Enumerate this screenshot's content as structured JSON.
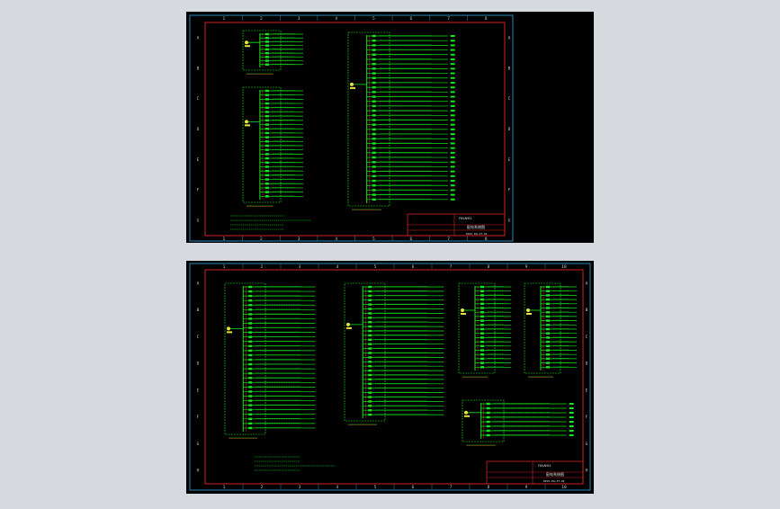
{
  "colors": {
    "background": "#d6d9dd",
    "paper": "#000000",
    "frame": "#2a8ab8",
    "border": "#d22222",
    "wiring": "#12e81a",
    "text": "#e0e0e0"
  },
  "sheet1": {
    "col_labels_top": [
      "1",
      "2",
      "3",
      "4",
      "5",
      "6",
      "7",
      "8"
    ],
    "col_labels_bottom": [
      "1",
      "2",
      "3",
      "4",
      "5",
      "6",
      "7",
      "8"
    ],
    "row_labels_left": [
      "A",
      "B",
      "C",
      "D",
      "E",
      "F",
      "G"
    ],
    "row_labels_right": [
      "A",
      "B",
      "C",
      "D",
      "E",
      "F",
      "G"
    ],
    "title_block": {
      "company": "FKVAHS1",
      "drawing_title": "配电系统图",
      "drawing_no": "DPZJ-DQ-XT-01"
    }
  },
  "sheet2": {
    "col_labels_top": [
      "1",
      "2",
      "3",
      "4",
      "5",
      "6",
      "7",
      "8",
      "9",
      "10"
    ],
    "col_labels_bottom": [
      "1",
      "2",
      "3",
      "4",
      "5",
      "6",
      "7",
      "8",
      "9",
      "10"
    ],
    "row_labels_left": [
      "A",
      "B",
      "C",
      "D",
      "E",
      "F",
      "G",
      "H"
    ],
    "row_labels_right": [
      "A",
      "B",
      "C",
      "D",
      "E",
      "F",
      "G",
      "H"
    ],
    "title_block": {
      "company": "FKVAHS1",
      "drawing_title": "配电系统图",
      "drawing_no": "DPZJ-DQ-XT-02"
    }
  },
  "icons": {
    "drawing_sheet": "cad-sheet-icon"
  }
}
